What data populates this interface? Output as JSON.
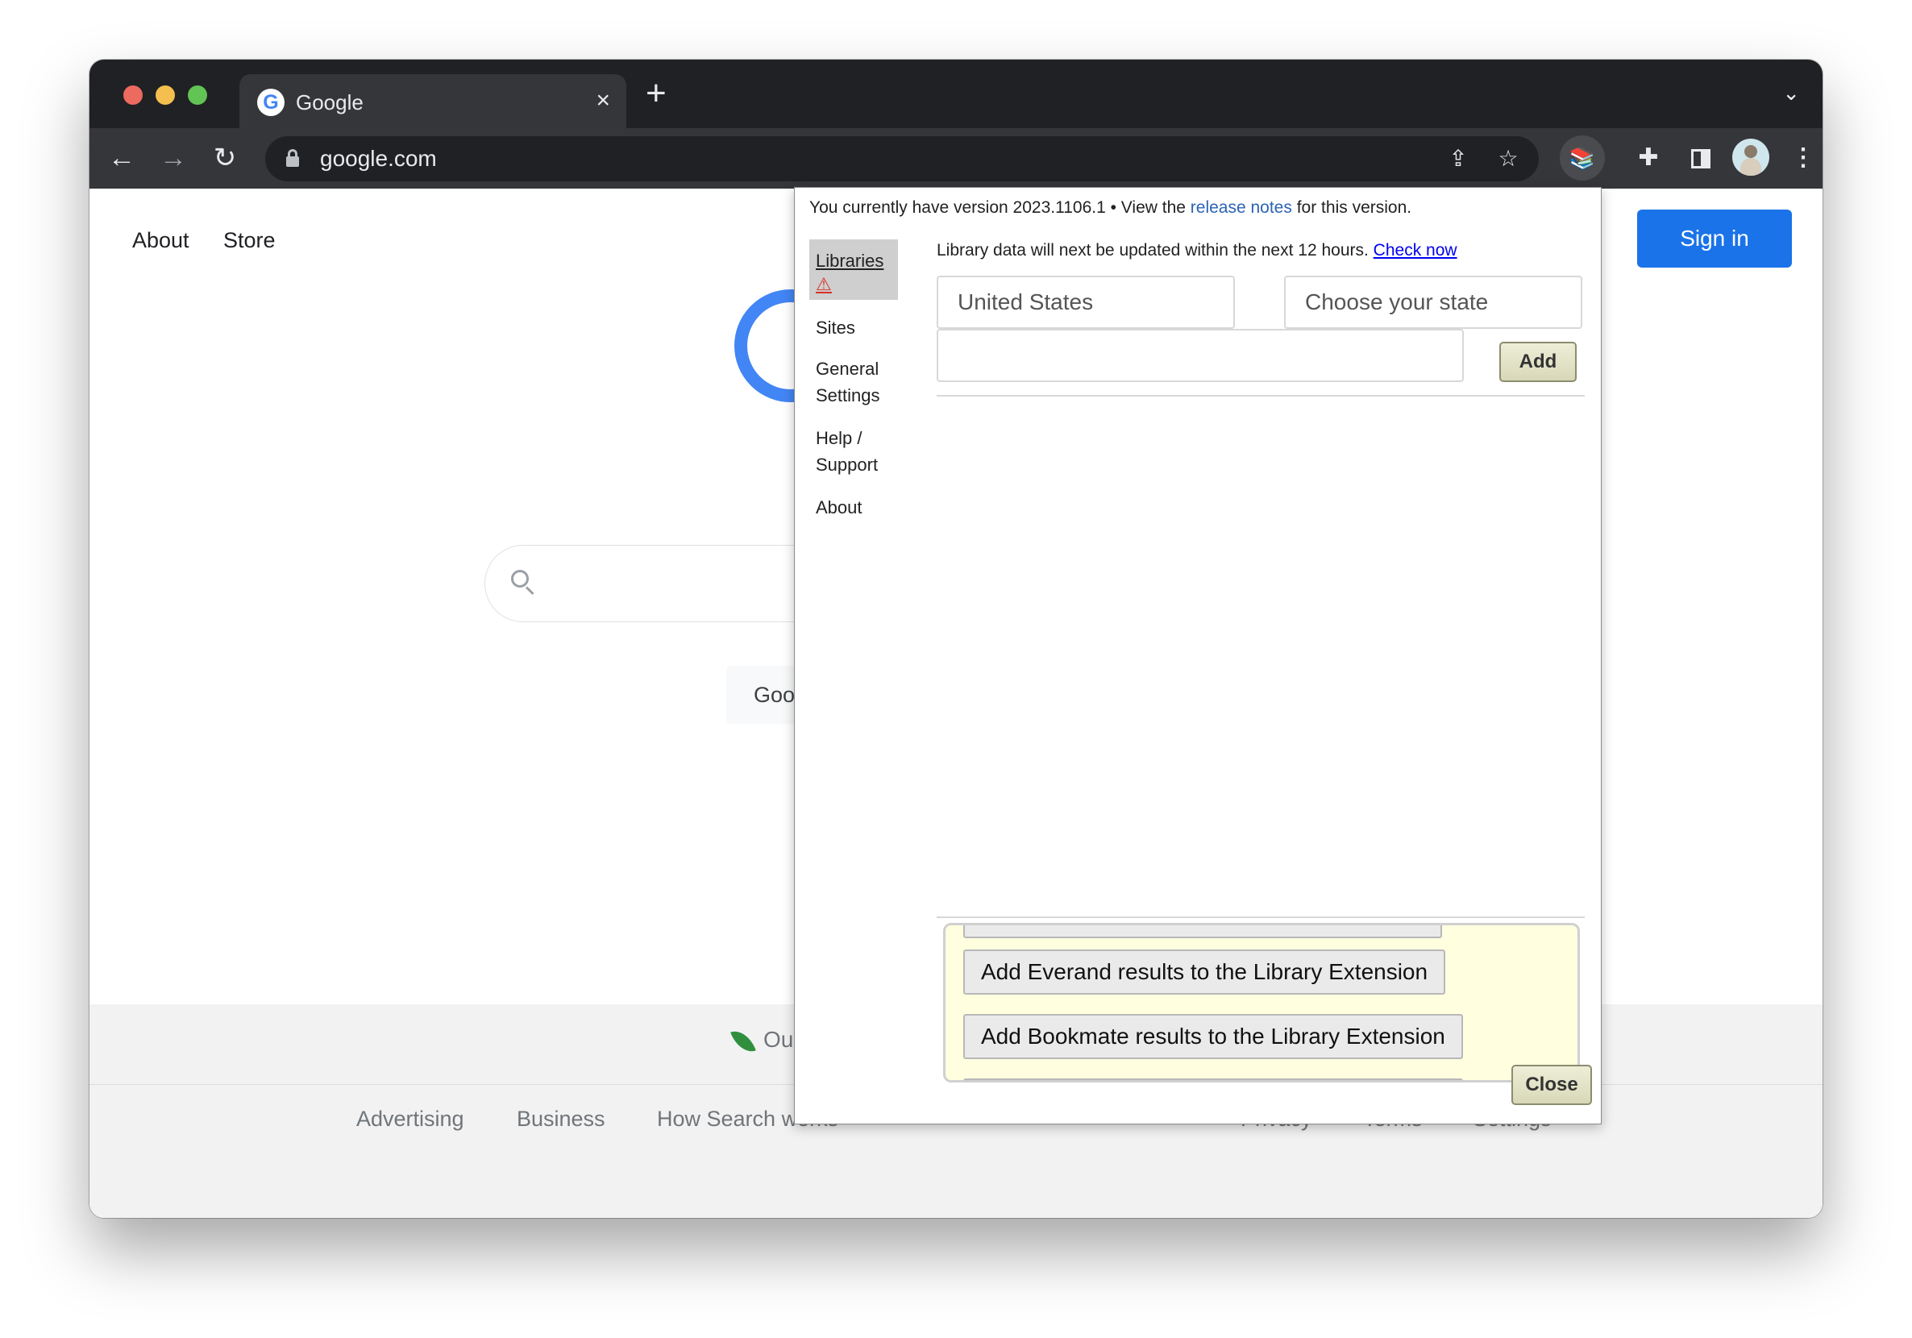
{
  "browser": {
    "tab_title": "Google",
    "tab_close": "×",
    "new_tab": "+",
    "tab_menu": "⌄",
    "url": "google.com"
  },
  "page": {
    "top_links": [
      "About",
      "Store"
    ],
    "sign_in": "Sign in",
    "google_button": "Goo",
    "carbon_text": "Ou",
    "footer_links": [
      "Advertising",
      "Business",
      "How Search works",
      "Privacy",
      "Terms",
      "Settings"
    ]
  },
  "popup": {
    "version_prefix": "You currently have version 2023.1106.1 • View the ",
    "version_link": "release notes",
    "version_suffix": " for this version.",
    "nav": {
      "libraries": "Libraries",
      "warning": "⚠",
      "sites": "Sites",
      "general_1": "General",
      "general_2": "Settings",
      "help_1": "Help /",
      "help_2": "Support",
      "about": "About"
    },
    "update_text": "Library data will next be updated within the next 12 hours. ",
    "check_now": "Check now",
    "country_select": "United States",
    "state_select": "Choose your state",
    "library_input_value": "",
    "add_button": "Add",
    "promo_everand": "Add Everand results to the Library Extension",
    "promo_bookmate": "Add Bookmate results to the Library Extension",
    "close_button": "Close"
  },
  "icons": {
    "back": "back-arrow-icon",
    "forward": "forward-arrow-icon",
    "reload": "reload-icon",
    "lock": "lock-icon",
    "share": "share-icon",
    "star": "bookmark-star-icon",
    "extension": "library-extension-icon",
    "puzzle": "extensions-puzzle-icon",
    "side_panel": "side-panel-icon",
    "avatar": "profile-avatar-icon",
    "menu": "kebab-menu-icon",
    "search": "search-icon",
    "leaf": "leaf-icon"
  },
  "colors": {
    "chrome_dark": "#202124",
    "toolbar": "#35363a",
    "sign_in_blue": "#1a73e8",
    "promo_background": "#ffffe0",
    "warning_red": "#d93025",
    "link_blue": "#0000ee"
  }
}
